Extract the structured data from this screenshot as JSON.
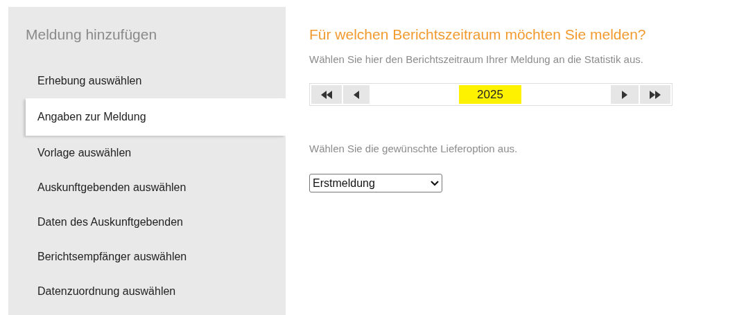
{
  "sidebar": {
    "title": "Meldung hinzufügen",
    "items": [
      {
        "label": "Erhebung auswählen",
        "selected": false
      },
      {
        "label": "Angaben zur Meldung",
        "selected": true
      },
      {
        "label": "Vorlage auswählen",
        "selected": false
      },
      {
        "label": "Auskunftgebenden auswählen",
        "selected": false
      },
      {
        "label": "Daten des Auskunftgebenden",
        "selected": false
      },
      {
        "label": "Berichtsempfänger auswählen",
        "selected": false
      },
      {
        "label": "Datenzuordnung auswählen",
        "selected": false
      }
    ]
  },
  "main": {
    "heading": "Für welchen Berichtszeitraum möchten Sie melden?",
    "period_hint": "Wählen Sie hier den Berichtszeitraum Ihrer Meldung an die Statistik aus.",
    "period_picker": {
      "value": "2025",
      "highlighted": true
    },
    "delivery_hint": "Wählen Sie die gewünschte Lieferoption aus.",
    "delivery_select": {
      "value": "Erstmeldung"
    }
  }
}
